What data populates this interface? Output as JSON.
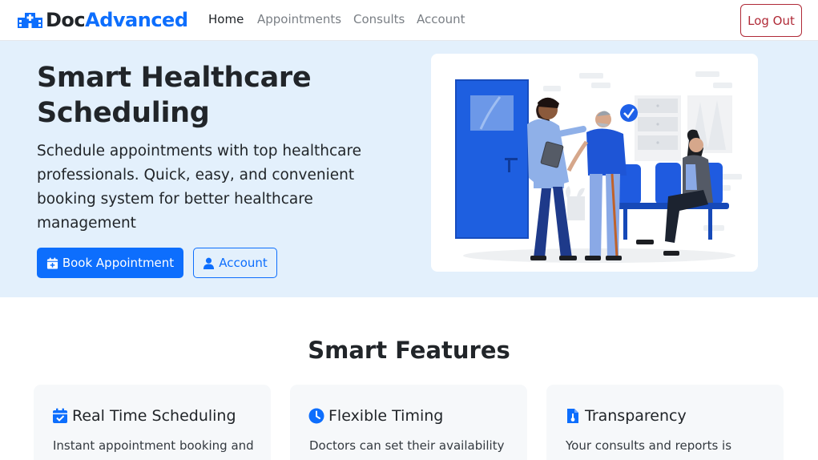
{
  "brand": {
    "name_part1": "Doc",
    "name_part2": "Advanced",
    "icon": "hospital-icon"
  },
  "nav": {
    "items": [
      {
        "label": "Home",
        "active": true
      },
      {
        "label": "Appointments",
        "active": false
      },
      {
        "label": "Consults",
        "active": false
      },
      {
        "label": "Account",
        "active": false
      }
    ],
    "logout_label": "Log Out"
  },
  "hero": {
    "title": "Smart Healthcare Scheduling",
    "description": "Schedule appointments with top healthcare professionals. Quick, easy, and convenient booking system for better healthcare management",
    "primary_button": {
      "label": "Book Appointment",
      "icon": "calendar-plus-icon"
    },
    "secondary_button": {
      "label": "Account",
      "icon": "user-icon"
    },
    "illustration": "doctor-patient-clinic-illustration"
  },
  "features": {
    "title": "Smart Features",
    "cards": [
      {
        "title": "Real Time Scheduling",
        "text": "Instant appointment booking and",
        "icon": "calendar-check-icon"
      },
      {
        "title": "Flexible Timing",
        "text": "Doctors can set their availability",
        "icon": "clock-icon"
      },
      {
        "title": "Transparency",
        "text": "Your consults and reports is",
        "icon": "file-medical-icon"
      }
    ]
  },
  "colors": {
    "primary": "#0d6efd",
    "danger": "#b02a37",
    "hero_bg": "#e3f0fc",
    "card_bg": "#f6f8fa"
  }
}
